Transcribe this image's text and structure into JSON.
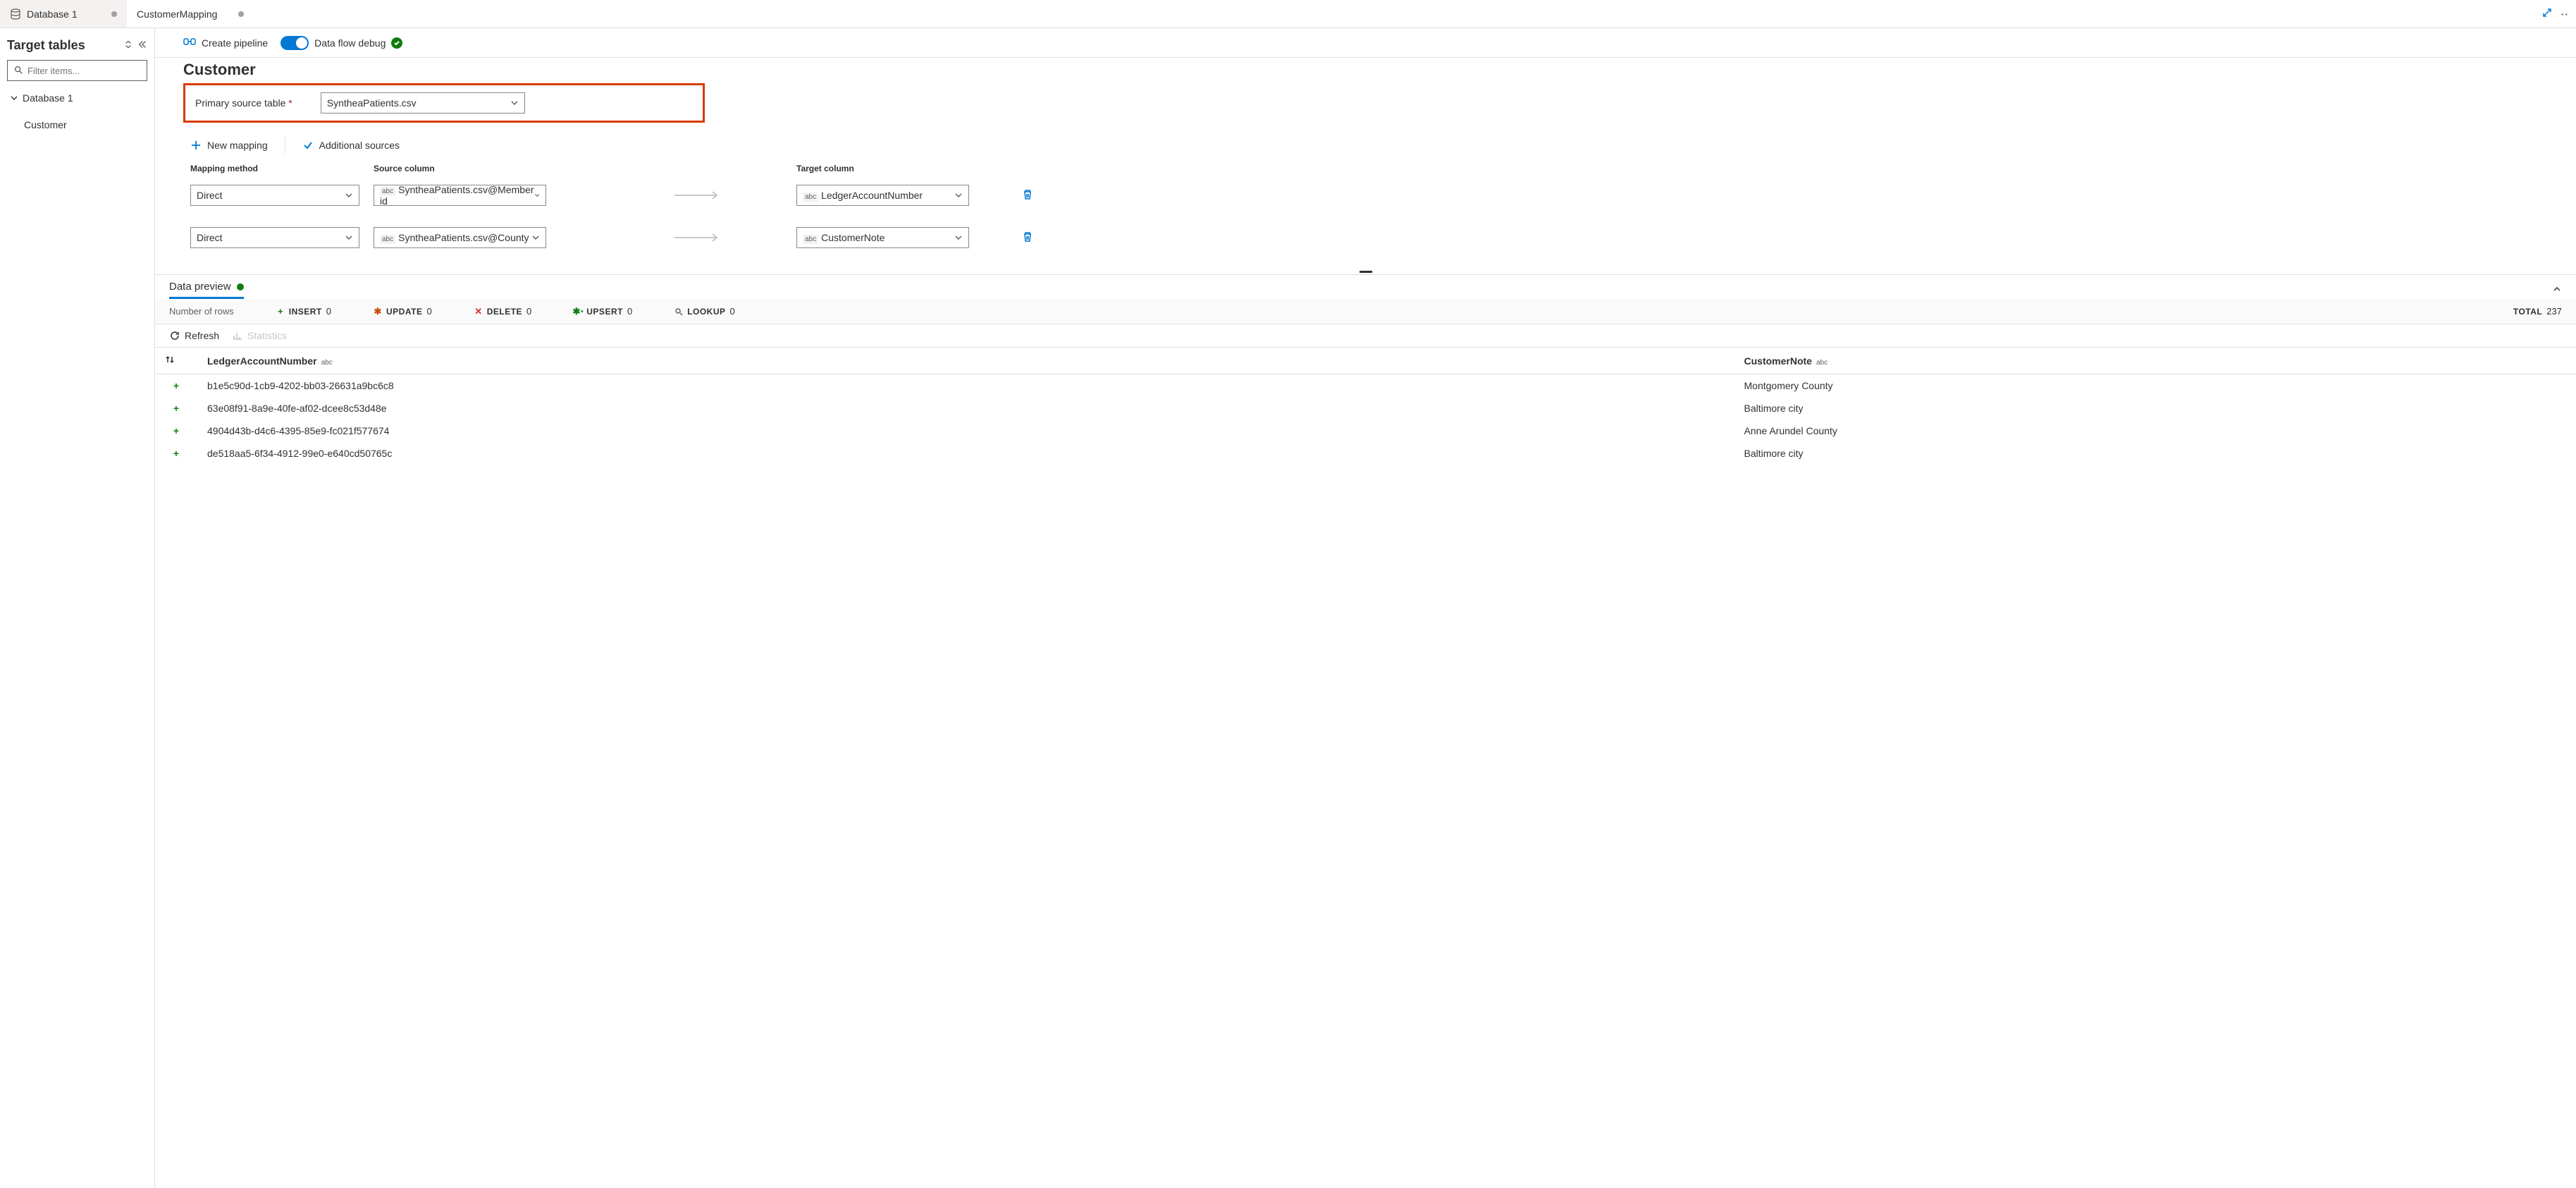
{
  "tabs": [
    {
      "label": "Database 1",
      "dirty": true,
      "active": false
    },
    {
      "label": "CustomerMapping",
      "dirty": true,
      "active": true
    }
  ],
  "sidebar": {
    "title": "Target tables",
    "filter_placeholder": "Filter items...",
    "tree": {
      "root_label": "Database 1",
      "children": [
        {
          "label": "Customer"
        }
      ]
    }
  },
  "toolbar": {
    "create_pipeline_label": "Create pipeline",
    "debug_label": "Data flow debug"
  },
  "section": {
    "title": "Customer",
    "primary_source_label": "Primary source table",
    "primary_source_value": "SyntheaPatients.csv"
  },
  "actions": {
    "new_mapping_label": "New mapping",
    "additional_sources_label": "Additional sources"
  },
  "mapping": {
    "headers": {
      "method": "Mapping method",
      "source": "Source column",
      "target": "Target column"
    },
    "rows": [
      {
        "method": "Direct",
        "source_type": "abc",
        "source": "SyntheaPatients.csv@Member id",
        "target_type": "abc",
        "target": "LedgerAccountNumber"
      },
      {
        "method": "Direct",
        "source_type": "abc",
        "source": "SyntheaPatients.csv@County",
        "target_type": "abc",
        "target": "CustomerNote"
      }
    ]
  },
  "preview": {
    "tab_label": "Data preview",
    "rows_label": "Number of rows",
    "stats": {
      "insert_label": "INSERT",
      "insert_val": "0",
      "update_label": "UPDATE",
      "update_val": "0",
      "delete_label": "DELETE",
      "delete_val": "0",
      "upsert_label": "UPSERT",
      "upsert_val": "0",
      "lookup_label": "LOOKUP",
      "lookup_val": "0",
      "total_label": "TOTAL",
      "total_val": "237"
    },
    "refresh_label": "Refresh",
    "statistics_label": "Statistics",
    "columns": [
      {
        "name": "LedgerAccountNumber",
        "type": "abc"
      },
      {
        "name": "CustomerNote",
        "type": "abc"
      }
    ],
    "rows": [
      {
        "c0": "b1e5c90d-1cb9-4202-bb03-26631a9bc6c8",
        "c1": "Montgomery County"
      },
      {
        "c0": "63e08f91-8a9e-40fe-af02-dcee8c53d48e",
        "c1": "Baltimore city"
      },
      {
        "c0": "4904d43b-d4c6-4395-85e9-fc021f577674",
        "c1": "Anne Arundel County"
      },
      {
        "c0": "de518aa5-6f34-4912-99e0-e640cd50765c",
        "c1": "Baltimore city"
      }
    ]
  }
}
